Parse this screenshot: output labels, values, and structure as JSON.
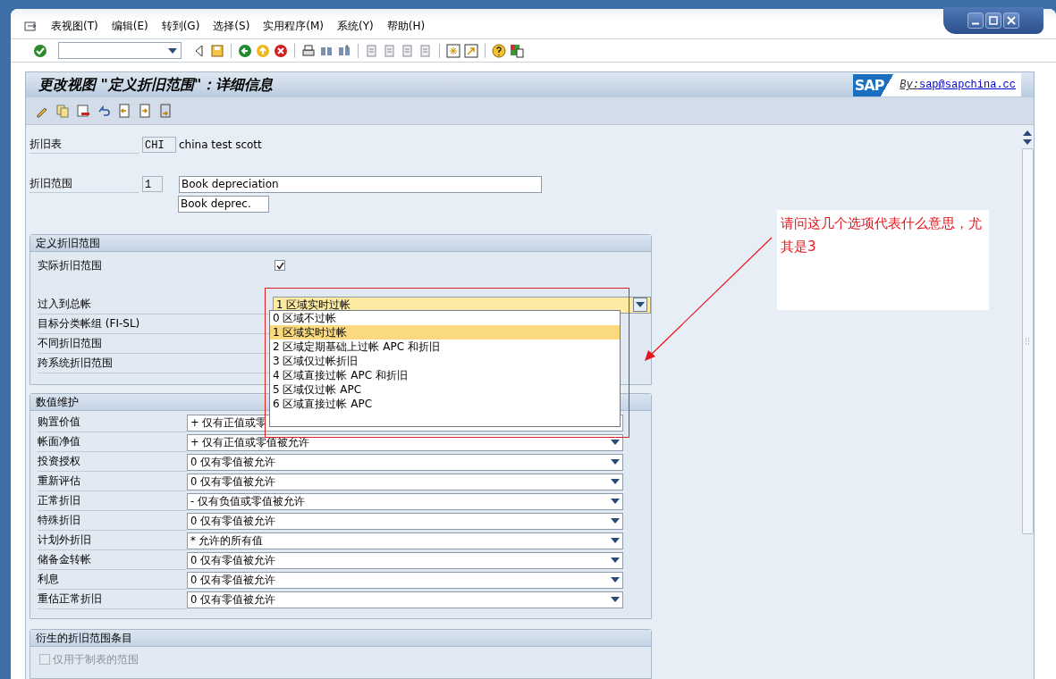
{
  "menu": [
    "表视图(T)",
    "编辑(E)",
    "转到(G)",
    "选择(S)",
    "实用程序(M)",
    "系统(Y)",
    "帮助(H)"
  ],
  "title": "更改视图 \"定义折旧范围\"：详细信息",
  "logo": {
    "brand": "SAP",
    "by": "By:",
    "link": "sap@sapchina.cc"
  },
  "header": {
    "chart": {
      "label": "折旧表",
      "code": "CHI",
      "description": "china test scott"
    },
    "area": {
      "label": "折旧范围",
      "code": "1",
      "name": "Book depreciation",
      "short_name": "Book deprec."
    }
  },
  "define_group": {
    "title": "定义折旧范围",
    "rows": [
      {
        "kind": "checkbox",
        "label": "实际折旧范围",
        "checked": true
      },
      {
        "kind": "dropdown",
        "label": "过入到总帐",
        "value": "1 区域实时过帐"
      },
      {
        "kind": "label",
        "label": "目标分类帐组 (FI-SL)"
      },
      {
        "kind": "label",
        "label": "不同折旧范围"
      },
      {
        "kind": "label",
        "label": "跨系统折旧范围"
      }
    ]
  },
  "dropdown_list": {
    "options": [
      {
        "label": "0 区域不过帐",
        "selected": false
      },
      {
        "label": "1 区域实时过帐",
        "selected": true
      },
      {
        "label": "2 区域定期基础上过帐 APC 和折旧",
        "selected": false
      },
      {
        "label": "3 区域仅过帐折旧",
        "selected": false
      },
      {
        "label": "4 区域直接过帐 APC 和折旧",
        "selected": false
      },
      {
        "label": "5 区域仅过帐 APC",
        "selected": false
      },
      {
        "label": "6 区域直接过帐 APC",
        "selected": false
      }
    ]
  },
  "value_group": {
    "title": "数值维护",
    "rows": [
      {
        "label": "购置价值",
        "value": "+ 仅有正值或零"
      },
      {
        "label": "帐面净值",
        "value": "+ 仅有正值或零值被允许"
      },
      {
        "label": "投资授权",
        "value": "0 仅有零值被允许"
      },
      {
        "label": "重新评估",
        "value": "0 仅有零值被允许"
      },
      {
        "label": "正常折旧",
        "value": "- 仅有负值或零值被允许"
      },
      {
        "label": "特殊折旧",
        "value": "0 仅有零值被允许"
      },
      {
        "label": "计划外折旧",
        "value": "* 允许的所有值"
      },
      {
        "label": "储备金转帐",
        "value": "0 仅有零值被允许"
      },
      {
        "label": "利息",
        "value": "0 仅有零值被允许"
      },
      {
        "label": "重估正常折旧",
        "value": "0 仅有零值被允许"
      }
    ]
  },
  "derived_group": {
    "title": "衍生的折旧范围条目",
    "option": {
      "label": "仅用于制表的范围",
      "checked": false,
      "disabled": true
    }
  },
  "annotation": {
    "text": "请问这几个选项代表什么意思，尤其是3"
  }
}
